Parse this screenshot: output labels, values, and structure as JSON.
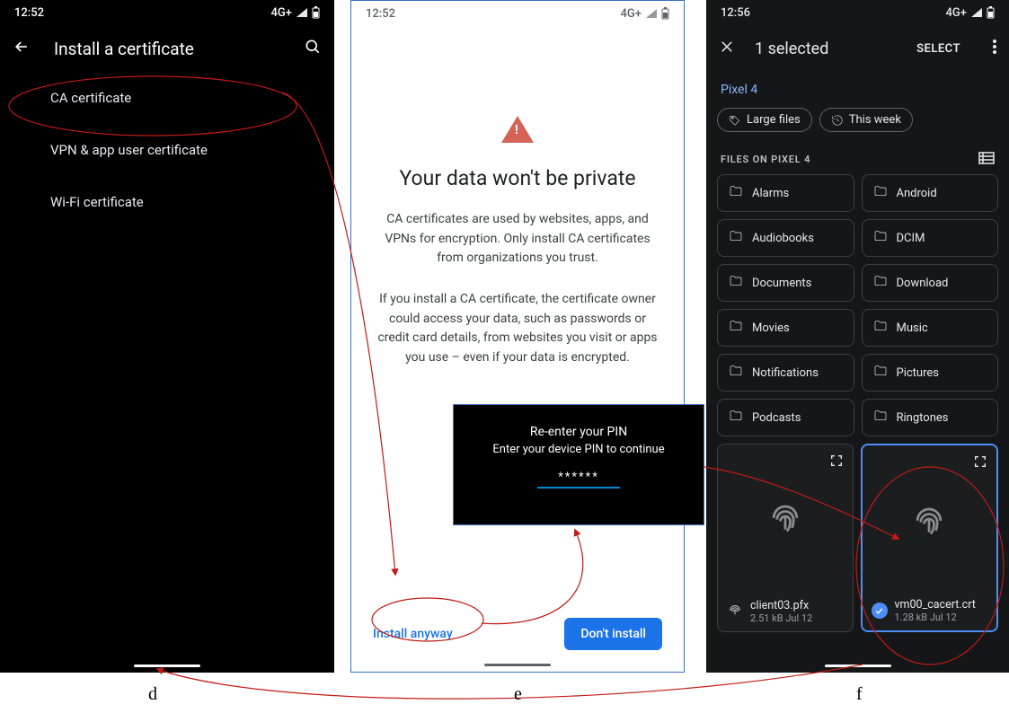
{
  "captions": {
    "d": "d",
    "e": "e",
    "f": "f"
  },
  "screenA": {
    "time": "12:52",
    "net": "4G+",
    "title": "Install a certificate",
    "items": [
      "CA certificate",
      "VPN & app user certificate",
      "Wi-Fi certificate"
    ]
  },
  "screenB": {
    "time": "12:52",
    "net": "4G+",
    "title": "Your data won't be private",
    "p1": "CA certificates are used by websites, apps, and VPNs for encryption. Only install CA certificates from organizations you trust.",
    "p2": "If you install a CA certificate, the certificate owner could access your data, such as passwords or credit card details, from websites you visit or apps you use – even if your data is encrypted.",
    "install_label": "Install anyway",
    "dont_label": "Don't install"
  },
  "pin": {
    "title": "Re-enter your PIN",
    "sub": "Enter your device PIN to continue",
    "value": "******"
  },
  "screenC": {
    "time": "12:56",
    "net": "4G+",
    "title": "1 selected",
    "select_label": "SELECT",
    "crumb": "Pixel 4",
    "chip1": "Large files",
    "chip2": "This week",
    "section": "FILES ON PIXEL 4",
    "folders": [
      "Alarms",
      "Android",
      "Audiobooks",
      "DCIM",
      "Documents",
      "Download",
      "Movies",
      "Music",
      "Notifications",
      "Pictures",
      "Podcasts",
      "Ringtones"
    ],
    "file1": {
      "name": "client03.pfx",
      "sub": "2.51 kB  Jul 12"
    },
    "file2": {
      "name": "vm00_cacert.crt",
      "sub": "1.28 kB  Jul 12"
    }
  }
}
